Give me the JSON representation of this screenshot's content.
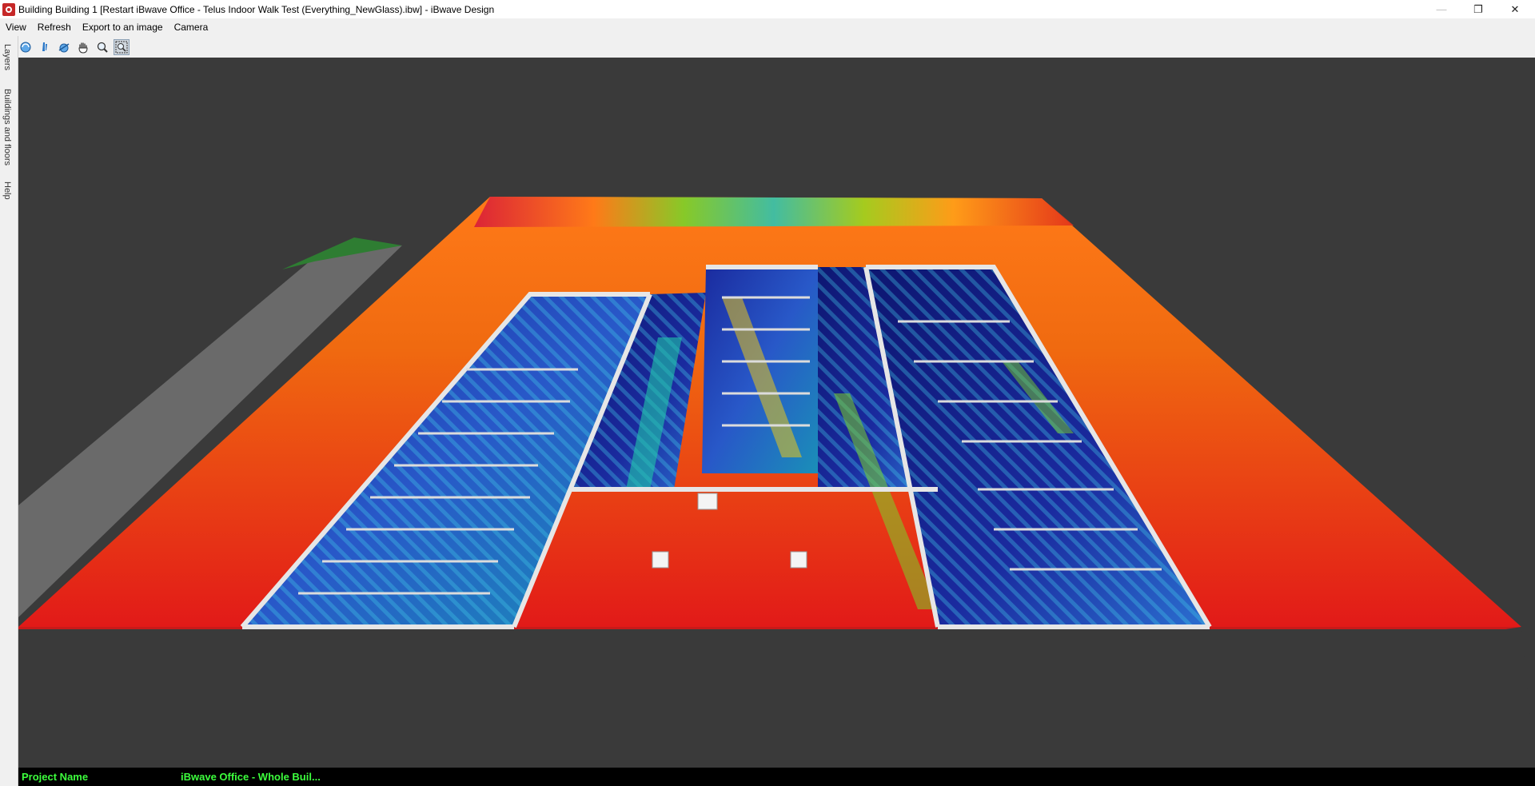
{
  "window": {
    "title": "Building Building 1 [Restart iBwave Office - Telus Indoor Walk Test (Everything_NewGlass).ibw] - iBwave Design",
    "minimize_glyph": "—",
    "restore_glyph": "❐",
    "close_glyph": "✕"
  },
  "menu": {
    "items": [
      "View",
      "Refresh",
      "Export to an image",
      "Camera"
    ]
  },
  "toolbar": {
    "tools": [
      {
        "icon": "rotate-icon"
      },
      {
        "icon": "walk-icon"
      },
      {
        "icon": "orbit-icon"
      },
      {
        "icon": "pan-hand-icon"
      },
      {
        "icon": "zoom-icon"
      },
      {
        "icon": "zoom-extents-icon",
        "active": true
      }
    ]
  },
  "side_tabs": [
    "Layers",
    "Buildings and floors",
    "Help"
  ],
  "status": {
    "label": "Project Name",
    "value": "iBwave Office - Whole Buil..."
  },
  "colors": {
    "viewport_bg": "#3a3a3a",
    "status_text": "#3dff3d",
    "heatmap_high": "#e8201c",
    "heatmap_low": "#1a237e"
  }
}
